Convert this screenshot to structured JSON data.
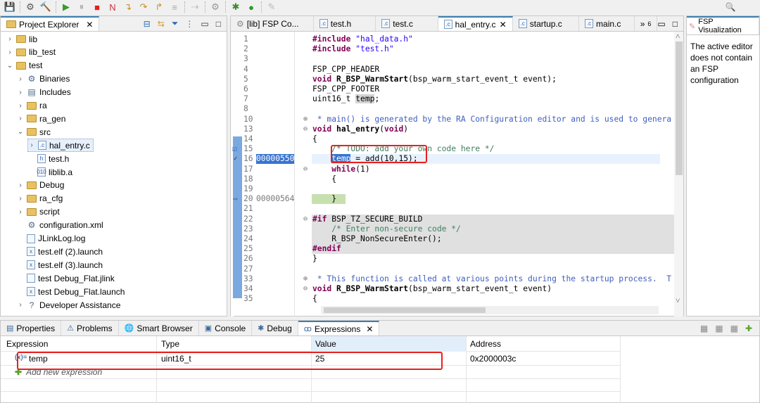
{
  "toolbar": {
    "icons": [
      "save-icon",
      "build-config-icon",
      "hammer-icon",
      "resume-icon",
      "suspend-icon",
      "terminate-icon",
      "disconnect-icon",
      "step-into-icon",
      "step-over-icon",
      "step-return-icon",
      "instruction-step-icon",
      "use-step-filters-icon",
      "settings-icon",
      "debug-icon",
      "run-icon",
      "pen-icon",
      "search-icon"
    ]
  },
  "explorer": {
    "title": "Project Explorer",
    "items": [
      {
        "label": "lib",
        "depth": 0,
        "chev": "›",
        "icon": "project"
      },
      {
        "label": "lib_test",
        "depth": 0,
        "chev": "›",
        "icon": "project"
      },
      {
        "label": "test",
        "depth": 0,
        "chev": "⌄",
        "icon": "project"
      },
      {
        "label": "Binaries",
        "depth": 1,
        "chev": "›",
        "icon": "binaries"
      },
      {
        "label": "Includes",
        "depth": 1,
        "chev": "›",
        "icon": "includes"
      },
      {
        "label": "ra",
        "depth": 1,
        "chev": "›",
        "icon": "folder"
      },
      {
        "label": "ra_gen",
        "depth": 1,
        "chev": "›",
        "icon": "folder"
      },
      {
        "label": "src",
        "depth": 1,
        "chev": "⌄",
        "icon": "folder"
      },
      {
        "label": "hal_entry.c",
        "depth": 2,
        "chev": "›",
        "icon": "c",
        "selected": true
      },
      {
        "label": "test.h",
        "depth": 2,
        "chev": "",
        "icon": "h"
      },
      {
        "label": "liblib.a",
        "depth": 2,
        "chev": "",
        "icon": "a"
      },
      {
        "label": "Debug",
        "depth": 1,
        "chev": "›",
        "icon": "folder"
      },
      {
        "label": "ra_cfg",
        "depth": 1,
        "chev": "›",
        "icon": "folder"
      },
      {
        "label": "script",
        "depth": 1,
        "chev": "›",
        "icon": "folder"
      },
      {
        "label": "configuration.xml",
        "depth": 1,
        "chev": "",
        "icon": "gear"
      },
      {
        "label": "JLinkLog.log",
        "depth": 1,
        "chev": "",
        "icon": "file"
      },
      {
        "label": "test.elf (2).launch",
        "depth": 1,
        "chev": "",
        "icon": "launch"
      },
      {
        "label": "test.elf (3).launch",
        "depth": 1,
        "chev": "",
        "icon": "launch"
      },
      {
        "label": "test Debug_Flat.jlink",
        "depth": 1,
        "chev": "",
        "icon": "file"
      },
      {
        "label": "test Debug_Flat.launch",
        "depth": 1,
        "chev": "",
        "icon": "launch"
      },
      {
        "label": "Developer Assistance",
        "depth": 1,
        "chev": "›",
        "icon": "help"
      }
    ]
  },
  "editor": {
    "tabs": [
      {
        "label": "[lib] FSP Co...",
        "icon": "gear"
      },
      {
        "label": "test.h",
        "icon": "c"
      },
      {
        "label": "test.c",
        "icon": "c"
      },
      {
        "label": "hal_entry.c",
        "icon": "c",
        "active": true
      },
      {
        "label": "startup.c",
        "icon": "c"
      },
      {
        "label": "main.c",
        "icon": "c"
      }
    ],
    "overflow": "»",
    "overflow_count": "6",
    "lines": [
      {
        "n": "1",
        "seg": [
          [
            "#include ",
            "pp"
          ],
          [
            "\"hal_data.h\"",
            "str"
          ]
        ]
      },
      {
        "n": "2",
        "seg": [
          [
            "#include ",
            "pp"
          ],
          [
            "\"test.h\"",
            "str"
          ]
        ]
      },
      {
        "n": "3",
        "seg": []
      },
      {
        "n": "4",
        "seg": [
          [
            "FSP_CPP_HEADER",
            ""
          ]
        ]
      },
      {
        "n": "5",
        "seg": [
          [
            "void ",
            "kw"
          ],
          [
            "R_BSP_WarmStart",
            "fn"
          ],
          [
            "(bsp_warm_start_event_t event);",
            ""
          ]
        ]
      },
      {
        "n": "6",
        "seg": [
          [
            "FSP_CPP_FOOTER",
            ""
          ]
        ]
      },
      {
        "n": "7",
        "seg": [
          [
            "uint16_t ",
            ""
          ],
          [
            "temp",
            "hl"
          ],
          [
            ";",
            ""
          ]
        ]
      },
      {
        "n": "8",
        "seg": []
      },
      {
        "n": "10",
        "seg": [
          [
            " * main() is generated by the RA Configuration editor and is used to genera",
            "doc"
          ]
        ],
        "fold": "+"
      },
      {
        "n": "13",
        "seg": [
          [
            "void ",
            "kw"
          ],
          [
            "hal_entry",
            "fn"
          ],
          [
            "(",
            ""
          ],
          [
            "void",
            "kw"
          ],
          [
            ")",
            ""
          ]
        ],
        "fold": "-"
      },
      {
        "n": "14",
        "seg": [
          [
            "{",
            ""
          ]
        ]
      },
      {
        "n": "15",
        "seg": [
          [
            "    /* TODO: add your own code here */",
            "cm"
          ]
        ]
      },
      {
        "n": "16",
        "addr": "00000550",
        "current": true,
        "seg": [
          [
            "    ",
            ""
          ],
          [
            "temp",
            "sel"
          ],
          [
            " = add(10,15);",
            ""
          ]
        ]
      },
      {
        "n": "17",
        "seg": [
          [
            "    ",
            ""
          ],
          [
            "while",
            "kw"
          ],
          [
            "(1)",
            ""
          ]
        ],
        "fold": "-"
      },
      {
        "n": "18",
        "seg": [
          [
            "    {",
            ""
          ]
        ]
      },
      {
        "n": "19",
        "seg": []
      },
      {
        "n": "20",
        "addr": "00000564",
        "seg": [
          [
            "    }",
            ""
          ]
        ]
      },
      {
        "n": "21",
        "seg": []
      },
      {
        "n": "22",
        "seg": [
          [
            "#if ",
            "pp"
          ],
          [
            "BSP_TZ_SECURE_BUILD",
            ""
          ]
        ],
        "fold": "-",
        "inactive": true
      },
      {
        "n": "23",
        "seg": [
          [
            "    /* Enter non-secure code */",
            "cm"
          ]
        ],
        "inactive": true
      },
      {
        "n": "24",
        "seg": [
          [
            "    R_BSP_NonSecureEnter();",
            ""
          ]
        ],
        "inactive": true
      },
      {
        "n": "25",
        "seg": [
          [
            "#endif",
            "pp"
          ]
        ],
        "inactive": true
      },
      {
        "n": "26",
        "seg": [
          [
            "}",
            ""
          ]
        ]
      },
      {
        "n": "27",
        "seg": []
      },
      {
        "n": "33",
        "seg": [
          [
            " * This function is called at various points during the startup process.  T",
            "doc"
          ]
        ],
        "fold": "+"
      },
      {
        "n": "34",
        "seg": [
          [
            "void ",
            "kw"
          ],
          [
            "R_BSP_WarmStart",
            "fn"
          ],
          [
            "(bsp_warm_start_event_t event)",
            ""
          ]
        ],
        "fold": "-"
      },
      {
        "n": "35",
        "seg": [
          [
            "{",
            ""
          ]
        ]
      }
    ]
  },
  "fsp": {
    "title": "FSP Visualization",
    "message": "The active editor does not contain an FSP configuration"
  },
  "bottom": {
    "tabs": [
      {
        "label": "Properties",
        "icon": "properties-icon"
      },
      {
        "label": "Problems",
        "icon": "problems-icon"
      },
      {
        "label": "Smart Browser",
        "icon": "smart-browser-icon"
      },
      {
        "label": "Console",
        "icon": "console-icon"
      },
      {
        "label": "Debug",
        "icon": "debug-icon"
      },
      {
        "label": "Expressions",
        "icon": "expressions-icon",
        "active": true
      }
    ],
    "columns": [
      "Expression",
      "Type",
      "Value",
      "Address"
    ],
    "rows": [
      {
        "expression": "temp",
        "type": "uint16_t",
        "value": "25",
        "address": "0x2000003c"
      }
    ],
    "add_new": "Add new expression"
  },
  "colors": {
    "annotation_red": "#e82020",
    "selection": "#3874d0",
    "current_line": "#e8f2fe",
    "ruler": "#7aa9e0"
  }
}
